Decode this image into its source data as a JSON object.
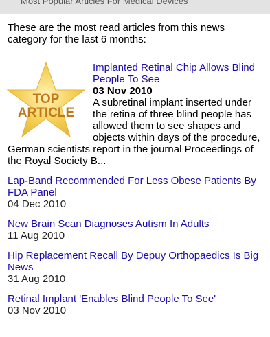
{
  "header": {
    "title": "Most Popular Articles For Medical Devices"
  },
  "intro": "These are the most read articles from this news category for the last 6 months:",
  "featured": {
    "badge_line1": "TOP",
    "badge_line2": "ARTICLE",
    "title": "Implanted Retinal Chip Allows Blind People To See",
    "date": "03 Nov 2010",
    "summary": "A subretinal implant inserted under the retina of three blind people has allowed them to see shapes and objects within days of the procedure, German scientists report in the journal Proceedings of the Royal Society B..."
  },
  "articles": [
    {
      "title": "Lap-Band Recommended For Less Obese Patients By FDA Panel",
      "date": "04 Dec 2010"
    },
    {
      "title": "New Brain Scan Diagnoses Autism In Adults",
      "date": "11 Aug 2010"
    },
    {
      "title": "Hip Replacement Recall By Depuy Orthopaedics Is Big News",
      "date": "31 Aug 2010"
    },
    {
      "title": "Retinal Implant 'Enables Blind People To See'",
      "date": "03 Nov 2010"
    }
  ],
  "colors": {
    "link": "#1a0dab",
    "badge_text": "#c0781a",
    "star_fill": "#f5cf55",
    "header_bg": "#e3e3e3"
  },
  "icons": {
    "badge": "top-article-star-icon"
  }
}
